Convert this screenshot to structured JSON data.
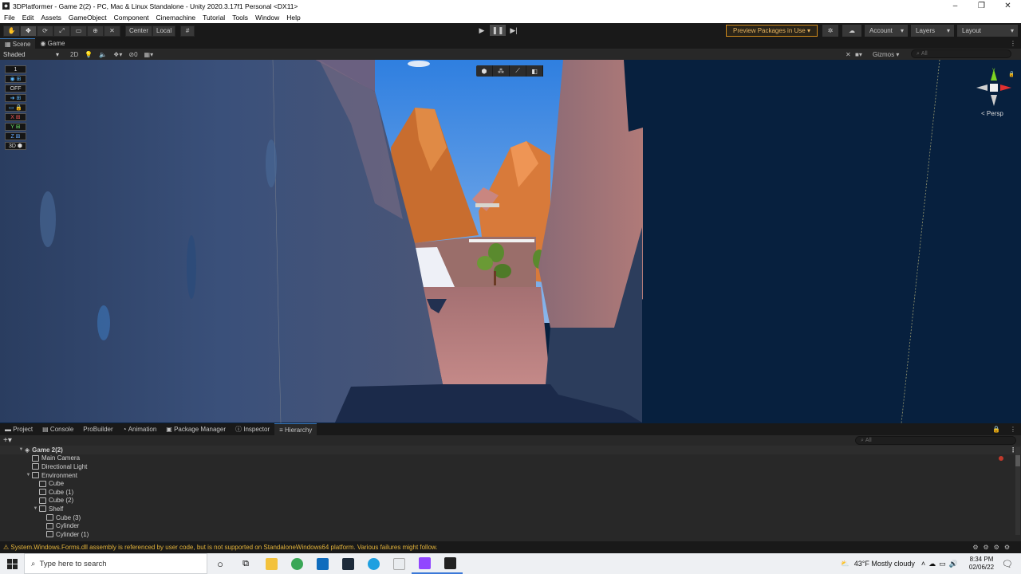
{
  "window": {
    "title": "3DPlatformer - Game 2(2) - PC, Mac & Linux Standalone - Unity 2020.3.17f1 Personal <DX11>",
    "controls": [
      "–",
      "❐",
      "✕"
    ]
  },
  "menu": [
    "File",
    "Edit",
    "Assets",
    "GameObject",
    "Component",
    "Cinemachine",
    "Tutorial",
    "Tools",
    "Window",
    "Help"
  ],
  "toolbar": {
    "pivot_center": "Center",
    "pivot_local": "Local",
    "preview_packages": "Preview Packages in Use",
    "account": "Account",
    "layers": "Layers",
    "layout": "Layout"
  },
  "scene_tabs": [
    "Scene",
    "Game"
  ],
  "scene_bar": {
    "shading_mode": "Shaded",
    "mode_2d": "2D",
    "hidden_count": "0",
    "gizmos": "Gizmos",
    "search_placeholder": "All"
  },
  "scene_tools": [
    "1",
    "OFF",
    "X",
    "Y",
    "Z",
    "3D"
  ],
  "viewport": {
    "projection": "Persp",
    "axis_labels": {
      "y": "y"
    }
  },
  "panel_tabs": [
    "Project",
    "Console",
    "ProBuilder",
    "Animation",
    "Package Manager",
    "Inspector",
    "Hierarchy"
  ],
  "hierarchy": {
    "search_placeholder": "All",
    "items": [
      {
        "label": "Game 2(2)",
        "depth": 0,
        "expanded": true,
        "root": true
      },
      {
        "label": "Main Camera",
        "depth": 1
      },
      {
        "label": "Directional Light",
        "depth": 1
      },
      {
        "label": "Environment",
        "depth": 1,
        "expanded": true
      },
      {
        "label": "Cube",
        "depth": 2
      },
      {
        "label": "Cube (1)",
        "depth": 2
      },
      {
        "label": "Cube (2)",
        "depth": 2
      },
      {
        "label": "Shelf",
        "depth": 2,
        "expanded": true
      },
      {
        "label": "Cube (3)",
        "depth": 3
      },
      {
        "label": "Cylinder",
        "depth": 3
      },
      {
        "label": "Cylinder (1)",
        "depth": 3
      }
    ]
  },
  "status": {
    "message": "System.Windows.Forms.dll assembly is referenced by user code, but is not supported on StandaloneWindows64 platform. Various failures might follow."
  },
  "taskbar": {
    "search_placeholder": "Type here to search",
    "weather": "43°F  Mostly cloudy",
    "time": "8:34 PM",
    "date": "02/06/22"
  },
  "colors": {
    "accent": "#3a79bb",
    "warning": "#e2b23a",
    "preview_border": "#d08a1b"
  }
}
